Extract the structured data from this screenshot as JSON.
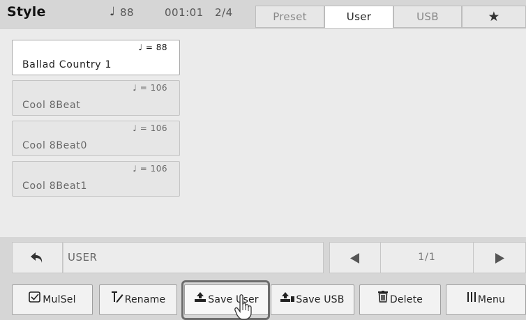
{
  "header": {
    "title": "Style",
    "tempo_symbol": "♩",
    "tempo": "88",
    "position": "001:01",
    "time_signature": "2/4",
    "tabs": [
      {
        "label": "Preset",
        "active": false
      },
      {
        "label": "User",
        "active": true
      },
      {
        "label": "USB",
        "active": false
      },
      {
        "label": "★",
        "icon": "star-icon",
        "active": false
      }
    ]
  },
  "styles": [
    {
      "name": "Ballad Country 1",
      "tempo": "♩ = 88",
      "selected": true
    },
    {
      "name": "Cool 8Beat",
      "tempo": "♩ = 106",
      "selected": false
    },
    {
      "name": "Cool 8Beat0",
      "tempo": "♩ = 106",
      "selected": false
    },
    {
      "name": "Cool 8Beat1",
      "tempo": "♩ = 106",
      "selected": false
    }
  ],
  "navbar": {
    "back_icon": "undo-arrow-icon",
    "folder": "USER",
    "prev_icon": "left-triangle-icon",
    "page": "1/1",
    "next_icon": "right-triangle-icon"
  },
  "buttons": {
    "mulsel": "MulSel",
    "rename": "Rename",
    "save_user": "Save User",
    "save_usb": "Save USB",
    "delete": "Delete",
    "menu": "Menu"
  },
  "colors": {
    "background": "#d6d6d6",
    "panel": "#ebebeb",
    "selected_item": "#ffffff",
    "item": "#e6e6e6"
  }
}
